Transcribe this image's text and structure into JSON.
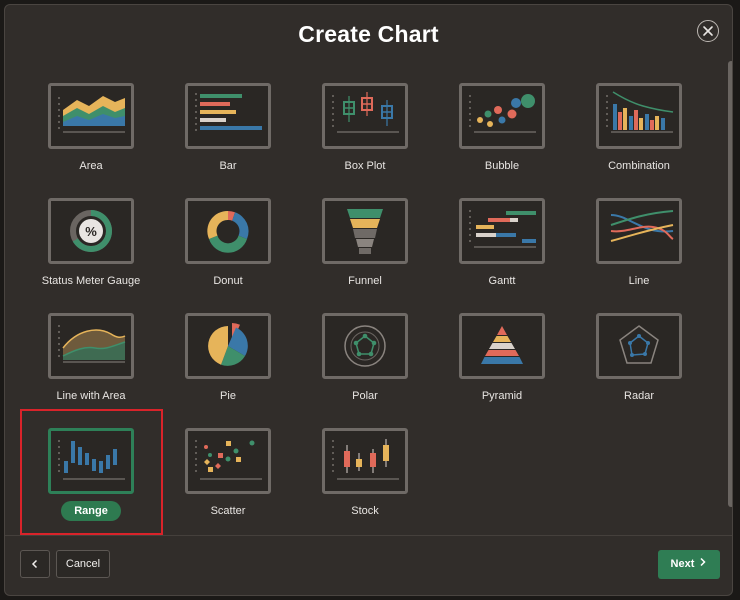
{
  "dialog": {
    "title": "Create Chart",
    "close_icon": "close-icon"
  },
  "chart_types": [
    {
      "label": "Area",
      "icon": "area-chart-icon",
      "selected": false
    },
    {
      "label": "Bar",
      "icon": "bar-chart-icon",
      "selected": false
    },
    {
      "label": "Box Plot",
      "icon": "box-plot-chart-icon",
      "selected": false
    },
    {
      "label": "Bubble",
      "icon": "bubble-chart-icon",
      "selected": false
    },
    {
      "label": "Combination",
      "icon": "combination-chart-icon",
      "selected": false
    },
    {
      "label": "Status Meter Gauge",
      "icon": "status-meter-gauge-icon",
      "selected": false
    },
    {
      "label": "Donut",
      "icon": "donut-chart-icon",
      "selected": false
    },
    {
      "label": "Funnel",
      "icon": "funnel-chart-icon",
      "selected": false
    },
    {
      "label": "Gantt",
      "icon": "gantt-chart-icon",
      "selected": false
    },
    {
      "label": "Line",
      "icon": "line-chart-icon",
      "selected": false
    },
    {
      "label": "Line with Area",
      "icon": "line-with-area-chart-icon",
      "selected": false
    },
    {
      "label": "Pie",
      "icon": "pie-chart-icon",
      "selected": false
    },
    {
      "label": "Polar",
      "icon": "polar-chart-icon",
      "selected": false
    },
    {
      "label": "Pyramid",
      "icon": "pyramid-chart-icon",
      "selected": false
    },
    {
      "label": "Radar",
      "icon": "radar-chart-icon",
      "selected": false
    },
    {
      "label": "Range",
      "icon": "range-chart-icon",
      "selected": true
    },
    {
      "label": "Scatter",
      "icon": "scatter-chart-icon",
      "selected": false
    },
    {
      "label": "Stock",
      "icon": "stock-chart-icon",
      "selected": false
    }
  ],
  "footer": {
    "back_icon": "chevron-left-icon",
    "cancel_label": "Cancel",
    "next_label": "Next",
    "next_icon": "chevron-right-icon"
  },
  "colors": {
    "accent_green": "#2e7a50",
    "highlight_red": "#d9232a",
    "chart_blue": "#3a78a8",
    "chart_green": "#3f8f6b",
    "chart_yellow": "#e6b45a",
    "chart_red": "#e06a5a",
    "dialog_bg": "#312d2a"
  }
}
